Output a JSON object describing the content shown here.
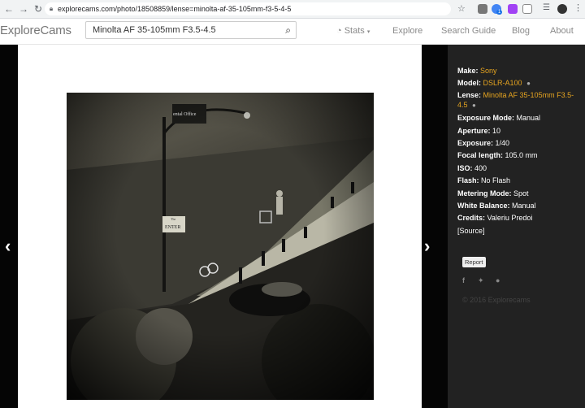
{
  "browser": {
    "url": "explorecams.com/photo/18508859/lense=minolta-af-35-105mm-f3-5-4-5",
    "badge_count": "1"
  },
  "header": {
    "logo": "ExploreCams",
    "search_value": "Minolta AF 35-105mm F3.5-4.5",
    "nav": [
      "Stats",
      "Explore",
      "Search Guide",
      "Blog",
      "About"
    ]
  },
  "details": {
    "make_label": "Make:",
    "make_value": "Sony",
    "model_label": "Model:",
    "model_value": "DSLR-A100",
    "lense_label": "Lense:",
    "lense_value": "Minolta AF 35-105mm F3.5-4.5",
    "exposure_mode_label": "Exposure Mode:",
    "exposure_mode_value": "Manual",
    "aperture_label": "Aperture:",
    "aperture_value": "10",
    "exposure_label": "Exposure:",
    "exposure_value": "1/40",
    "focal_label": "Focal length:",
    "focal_value": "105.0 mm",
    "iso_label": "ISO:",
    "iso_value": "400",
    "flash_label": "Flash:",
    "flash_value": "No Flash",
    "metering_label": "Metering Mode:",
    "metering_value": "Spot",
    "wb_label": "White Balance:",
    "wb_value": "Manual",
    "credits_label": "Credits:",
    "credits_value": "Valeriu Predoi",
    "source": "[Source]"
  },
  "actions": {
    "report": "Report"
  },
  "footer": {
    "copyright": "© 2016 Explorecams"
  },
  "photo": {
    "sign_top": "ental Office",
    "sign_small": "The",
    "sign_enter": "ENTER"
  },
  "colors": {
    "accent": "#e7a520",
    "panel": "#222222"
  }
}
